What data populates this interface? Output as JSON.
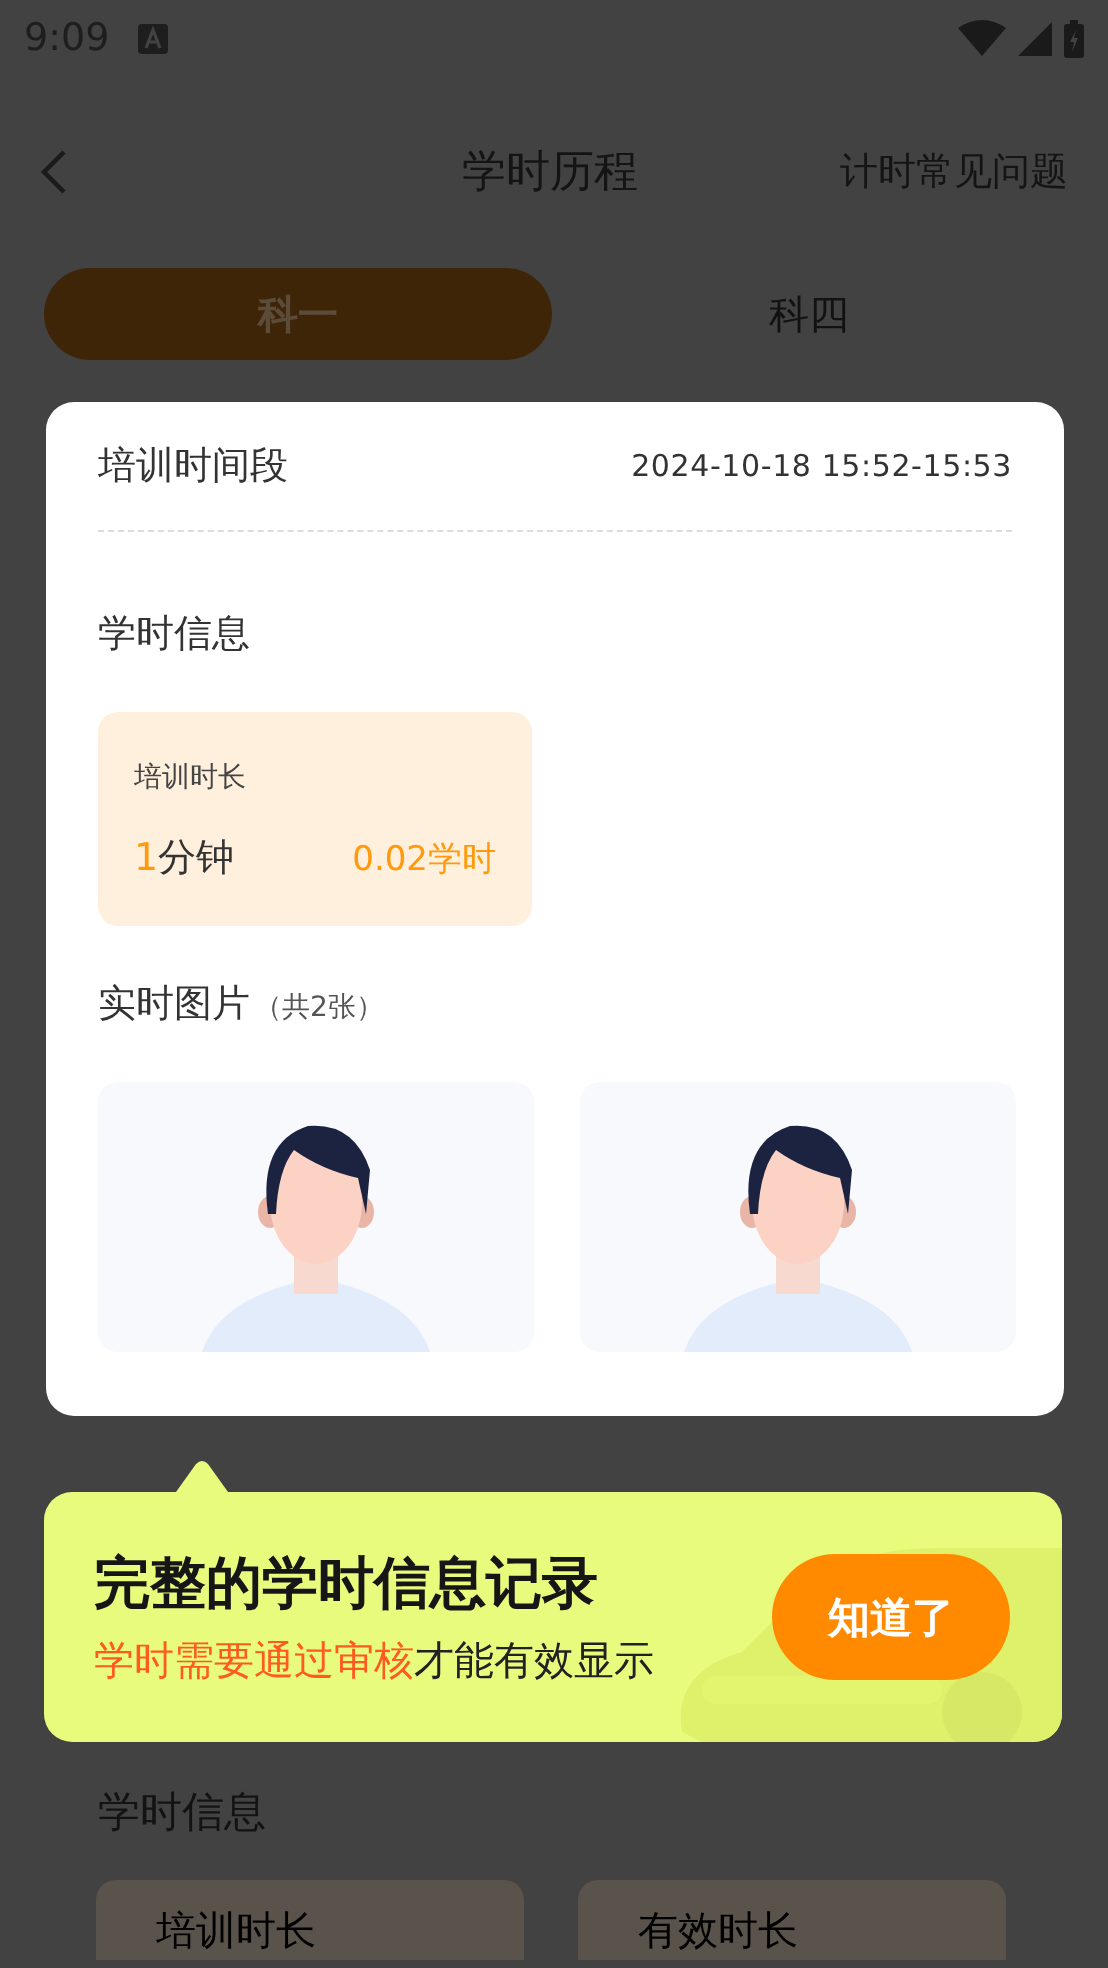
{
  "status_bar": {
    "time": "9:09"
  },
  "header": {
    "title": "学时历程",
    "action": "计时常见问题"
  },
  "tabs": [
    {
      "label": "科一",
      "selected": true
    },
    {
      "label": "科四",
      "selected": false
    }
  ],
  "background_section": {
    "title": "学时信息",
    "cards": [
      {
        "label": "培训时长"
      },
      {
        "label": "有效时长"
      }
    ]
  },
  "dialog": {
    "period_label": "培训时间段",
    "period_value": "2024-10-18 15:52-15:53",
    "info_title": "学时信息",
    "duration": {
      "label": "培训时长",
      "count": "1",
      "unit": "分钟",
      "hours": "0.02学时"
    },
    "photos_title": "实时图片",
    "photos_count": "（共2张）"
  },
  "tooltip": {
    "title": "完整的学时信息记录",
    "highlight": "学时需要通过审核",
    "rest": "才能有效显示",
    "button": "知道了"
  }
}
